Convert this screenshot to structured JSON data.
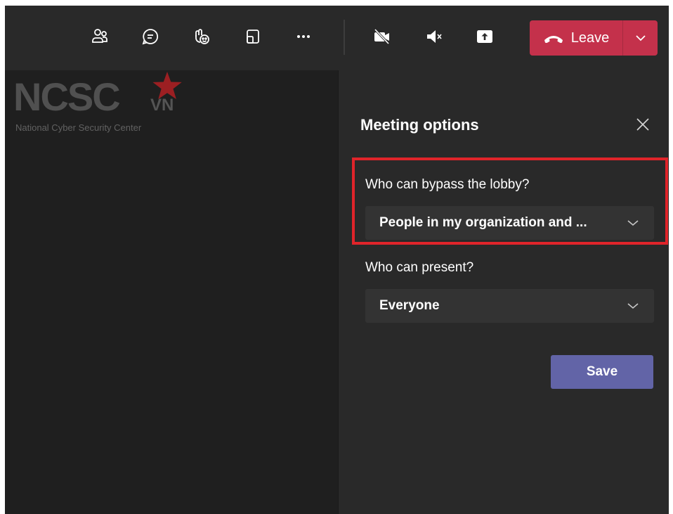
{
  "toolbar": {
    "icons": [
      "people-icon",
      "chat-icon",
      "reactions-icon",
      "share-tray-icon",
      "more-icon",
      "camera-off-icon",
      "mic-muted-icon",
      "share-screen-icon"
    ],
    "leave_label": "Leave",
    "leave_color": "#c4314b"
  },
  "watermark": {
    "logo_text": "NCSC",
    "logo_suffix": "VN",
    "subtitle": "National Cyber Security Center"
  },
  "meeting_options": {
    "title": "Meeting options",
    "bypass_lobby": {
      "label": "Who can bypass the lobby?",
      "value": "People in my organization and ..."
    },
    "presenters": {
      "label": "Who can present?",
      "value": "Everyone"
    },
    "save_label": "Save",
    "save_color": "#6264a7",
    "highlight_color": "#e0242a"
  }
}
